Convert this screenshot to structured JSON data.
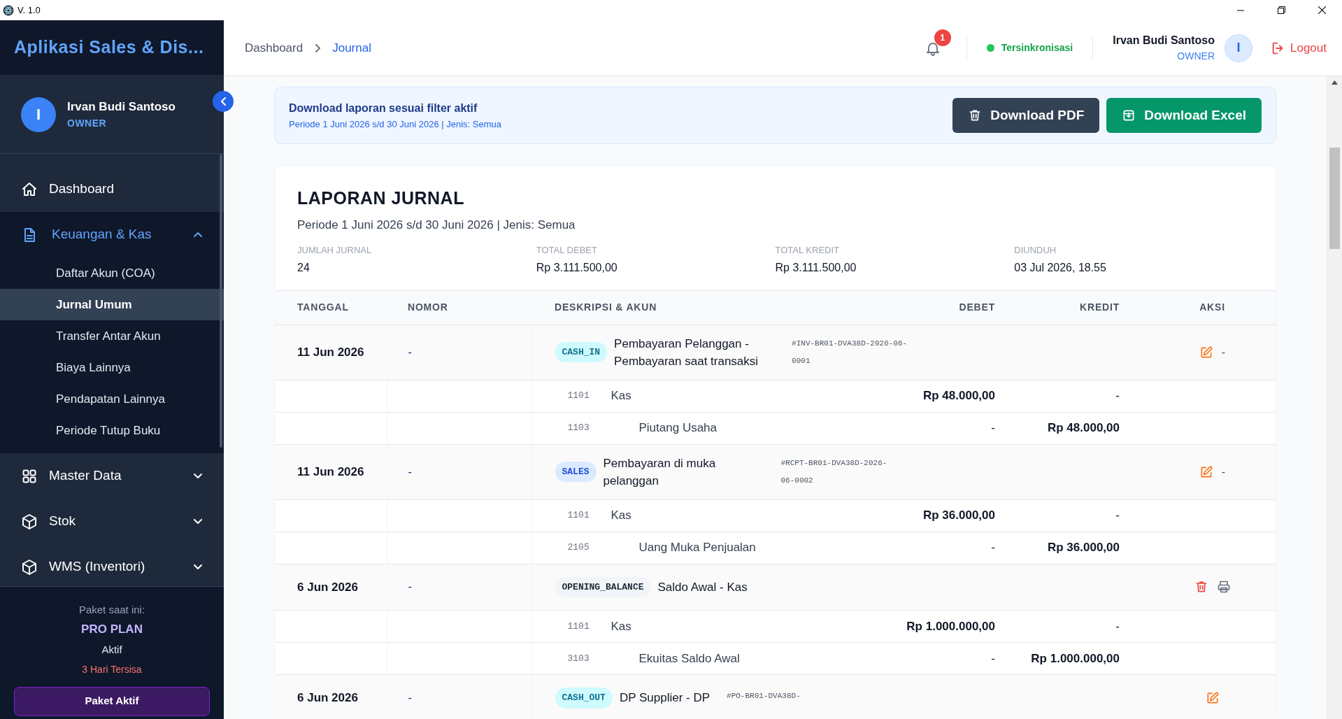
{
  "app_bar": {
    "version": "V. 1.0"
  },
  "sidebar": {
    "app_title": "Aplikasi Sales & Dis...",
    "user": {
      "initial": "I",
      "name": "Irvan Budi Santoso",
      "role": "OWNER"
    },
    "nav": [
      {
        "label": "Dashboard",
        "kind": "home",
        "expanded": false,
        "has_children": false
      },
      {
        "label": "Keuangan & Kas",
        "kind": "document",
        "expanded": true,
        "has_children": true,
        "children": [
          {
            "label": "Daftar Akun (COA)",
            "selected": false
          },
          {
            "label": "Jurnal Umum",
            "selected": true
          },
          {
            "label": "Transfer Antar Akun",
            "selected": false
          },
          {
            "label": "Biaya Lainnya",
            "selected": false
          },
          {
            "label": "Pendapatan Lainnya",
            "selected": false
          },
          {
            "label": "Periode Tutup Buku",
            "selected": false
          }
        ]
      },
      {
        "label": "Master Data",
        "kind": "grid",
        "expanded": false,
        "has_children": true
      },
      {
        "label": "Stok",
        "kind": "cube",
        "expanded": false,
        "has_children": true
      },
      {
        "label": "WMS (Inventori)",
        "kind": "cube",
        "expanded": false,
        "has_children": true
      }
    ],
    "plan": {
      "caption": "Paket saat ini:",
      "name": "PRO PLAN",
      "status": "Aktif",
      "remaining": "3 Hari Tersisa",
      "button": "Paket Aktif"
    }
  },
  "header": {
    "breadcrumb": [
      {
        "label": "Dashboard",
        "selected": false
      },
      {
        "label": "Journal",
        "selected": true
      }
    ],
    "notification_count": "1",
    "sync_status": "Tersinkronisasi",
    "user": {
      "name": "Irvan Budi Santoso",
      "role": "OWNER",
      "initial": "I"
    },
    "logout": "Logout"
  },
  "banner": {
    "title": "Download laporan sesuai filter aktif",
    "subtitle": "Periode 1 Juni 2026 s/d 30 Juni 2026 | Jenis: Semua",
    "buttons": [
      {
        "label": "Download PDF",
        "kind": "pdf"
      },
      {
        "label": "Download Excel",
        "kind": "excel"
      }
    ]
  },
  "report": {
    "title": "LAPORAN JURNAL",
    "period": "Periode 1 Juni 2026 s/d 30 Juni 2026 | Jenis: Semua",
    "stats": [
      {
        "label": "JUMLAH JURNAL",
        "value": "24"
      },
      {
        "label": "TOTAL DEBET",
        "value": "Rp 3.111.500,00"
      },
      {
        "label": "TOTAL KREDIT",
        "value": "Rp 3.111.500,00"
      },
      {
        "label": "DIUNDUH",
        "value": "03 Jul 2026, 18.55"
      }
    ],
    "table": {
      "columns": [
        "TANGGAL",
        "NOMOR",
        "DESKRIPSI & AKUN",
        "DEBET",
        "KREDIT",
        "AKSI"
      ],
      "entries": [
        {
          "date": "11 Jun 2026",
          "number": "-",
          "type": "CASH_IN",
          "color": "#cffafe",
          "description": "Pembayaran Pelanggan - Pembayaran saat transaksi",
          "reference": "#INV-BR01-DVA38D-2026-06-0001",
          "actions": [
            {
              "kind": "edit"
            },
            {
              "kind": "text",
              "text": "-"
            }
          ],
          "lines": [
            {
              "code": "1101",
              "account": "Kas",
              "kind": "debit",
              "debit": "Rp 48.000,00",
              "credit": "-"
            },
            {
              "code": "1103",
              "account": "Piutang Usaha",
              "kind": "credit",
              "debit": "-",
              "credit": "Rp 48.000,00"
            }
          ]
        },
        {
          "date": "11 Jun 2026",
          "number": "-",
          "type": "SALES",
          "color": "#dbeafe",
          "description": "Pembayaran di muka pelanggan",
          "reference": "#RCPT-BR01-DVA38D-2026-06-0002",
          "actions": [
            {
              "kind": "edit"
            },
            {
              "kind": "text",
              "text": "-"
            }
          ],
          "lines": [
            {
              "code": "1101",
              "account": "Kas",
              "kind": "debit",
              "debit": "Rp 36.000,00",
              "credit": "-"
            },
            {
              "code": "2105",
              "account": "Uang Muka Penjualan",
              "kind": "credit",
              "debit": "-",
              "credit": "Rp 36.000,00"
            }
          ]
        },
        {
          "date": "6 Jun 2026",
          "number": "-",
          "type": "OPENING_BALANCE",
          "color": "#f1f5f9",
          "description": "Saldo Awal - Kas",
          "actions": [
            {
              "kind": "delete"
            },
            {
              "kind": "print"
            }
          ],
          "lines": [
            {
              "code": "1101",
              "account": "Kas",
              "kind": "debit",
              "debit": "Rp 1.000.000,00",
              "credit": "-"
            },
            {
              "code": "3103",
              "account": "Ekuitas Saldo Awal",
              "kind": "credit",
              "debit": "-",
              "credit": "Rp 1.000.000,00"
            }
          ]
        },
        {
          "date": "6 Jun 2026",
          "number": "-",
          "type": "CASH_OUT",
          "color": "#cffafe",
          "description": "DP Supplier - DP",
          "reference": "#PO-BR01-DVA38D-",
          "actions": [
            {
              "kind": "edit"
            }
          ]
        }
      ]
    }
  }
}
